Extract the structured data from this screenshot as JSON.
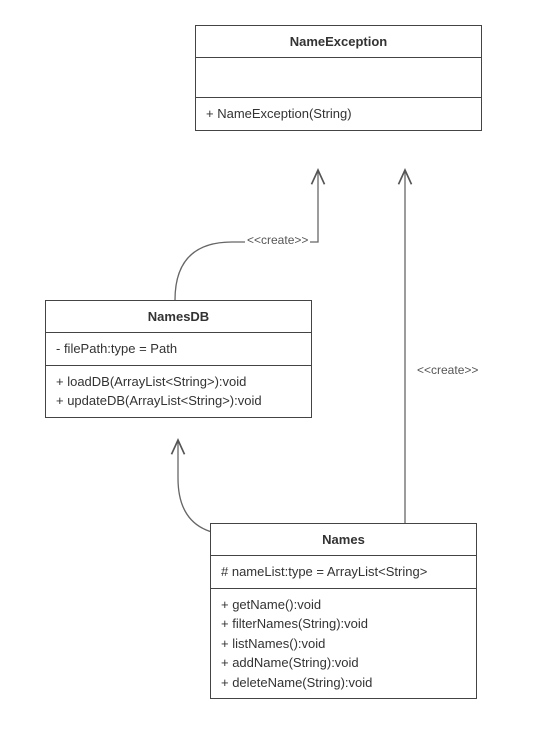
{
  "chart_data": {
    "type": "uml_class",
    "classes": [
      {
        "id": "NameException",
        "name": "NameException",
        "attributes": [],
        "operations": [
          {
            "vis": "+",
            "sig": "NameException(String)"
          }
        ]
      },
      {
        "id": "NamesDB",
        "name": "NamesDB",
        "attributes": [
          {
            "vis": "-",
            "sig": "filePath:type = Path"
          }
        ],
        "operations": [
          {
            "vis": "+",
            "sig": "loadDB(ArrayList<String>):void"
          },
          {
            "vis": "+",
            "sig": "updateDB(ArrayList<String>):void"
          }
        ]
      },
      {
        "id": "Names",
        "name": "Names",
        "attributes": [
          {
            "vis": "#",
            "sig": "nameList:type = ArrayList<String>"
          }
        ],
        "operations": [
          {
            "vis": "+",
            "sig": "getName():void"
          },
          {
            "vis": "+",
            "sig": "filterNames(String):void"
          },
          {
            "vis": "+",
            "sig": "listNames():void"
          },
          {
            "vis": "+",
            "sig": "addName(String):void"
          },
          {
            "vis": "+",
            "sig": "deleteName(String):void"
          }
        ]
      }
    ],
    "dependencies": [
      {
        "from": "NamesDB",
        "to": "NameException",
        "stereotype": "<<create>>"
      },
      {
        "from": "Names",
        "to": "NameException",
        "stereotype": "<<create>>"
      },
      {
        "from": "Names",
        "to": "NamesDB",
        "stereotype": ""
      }
    ]
  },
  "classes": {
    "NameException": {
      "name": "NameException",
      "op0": "+ NameException(String)"
    },
    "NamesDB": {
      "name": "NamesDB",
      "attr0": "- filePath:type = Path",
      "op0": "+ loadDB(ArrayList<String>):void",
      "op1": "+ updateDB(ArrayList<String>):void"
    },
    "Names": {
      "name": "Names",
      "attr0": "# nameList:type = ArrayList<String>",
      "op0": "+ getName():void",
      "op1": "+ filterNames(String):void",
      "op2": "+ listNames():void",
      "op3": "+ addName(String):void",
      "op4": "+ deleteName(String):void"
    }
  },
  "labels": {
    "create1": "<<create>>",
    "create2": "<<create>>"
  }
}
